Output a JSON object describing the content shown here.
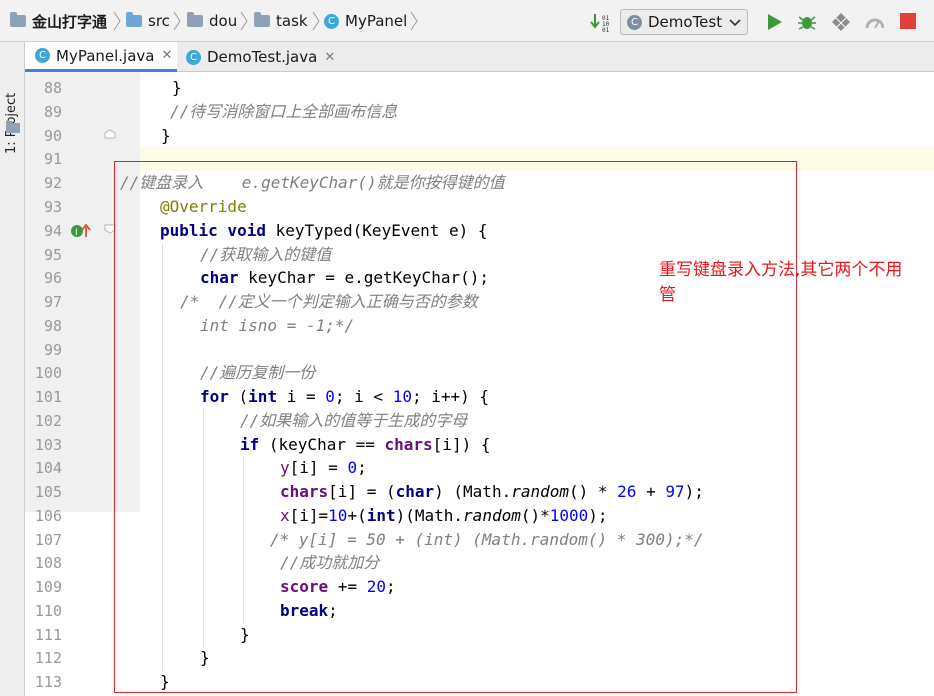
{
  "breadcrumb": {
    "items": [
      {
        "label": "金山打字通",
        "icon": "project-folder-icon"
      },
      {
        "label": "src",
        "icon": "source-folder-icon"
      },
      {
        "label": "dou",
        "icon": "package-folder-icon"
      },
      {
        "label": "task",
        "icon": "package-folder-icon"
      },
      {
        "label": "MyPanel",
        "icon": "class-icon"
      }
    ]
  },
  "toolbar": {
    "run_config": "DemoTest",
    "icons": [
      "build-icon",
      "run-icon",
      "debug-icon",
      "coverage-icon",
      "profile-icon",
      "stop-icon"
    ],
    "run_color": "#3c9a3c",
    "stop_color": "#e0413a"
  },
  "sidebar": {
    "project_label": "1: Project"
  },
  "tabs": [
    {
      "label": "MyPanel.java",
      "active": true
    },
    {
      "label": "DemoTest.java",
      "active": false
    }
  ],
  "editor": {
    "line_numbers": [
      "88",
      "89",
      "90",
      "91",
      "92",
      "93",
      "94",
      "95",
      "96",
      "97",
      "98",
      "99",
      "100",
      "101",
      "102",
      "103",
      "104",
      "105",
      "106",
      "107",
      "108",
      "109",
      "110",
      "111",
      "112",
      "113"
    ],
    "current_line_color": "#fdfbe8"
  },
  "annotation": {
    "note": "重写键盘录入方法,其它两个不用管",
    "color": "#e0242b"
  }
}
